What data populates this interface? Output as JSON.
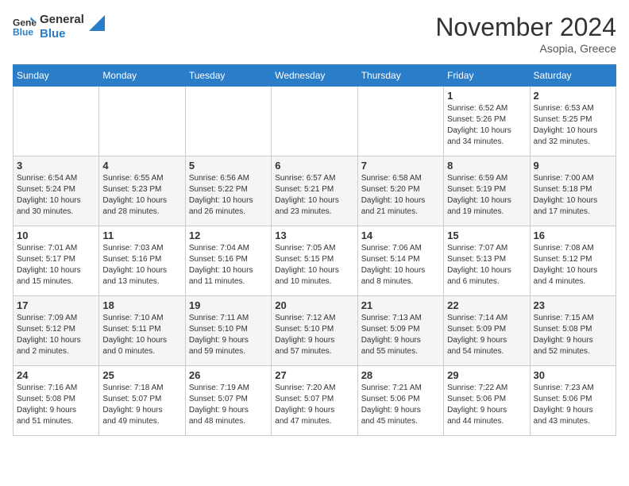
{
  "logo": {
    "line1": "General",
    "line2": "Blue"
  },
  "header": {
    "month": "November 2024",
    "location": "Asopia, Greece"
  },
  "weekdays": [
    "Sunday",
    "Monday",
    "Tuesday",
    "Wednesday",
    "Thursday",
    "Friday",
    "Saturday"
  ],
  "weeks": [
    [
      {
        "day": "",
        "info": ""
      },
      {
        "day": "",
        "info": ""
      },
      {
        "day": "",
        "info": ""
      },
      {
        "day": "",
        "info": ""
      },
      {
        "day": "",
        "info": ""
      },
      {
        "day": "1",
        "info": "Sunrise: 6:52 AM\nSunset: 5:26 PM\nDaylight: 10 hours\nand 34 minutes."
      },
      {
        "day": "2",
        "info": "Sunrise: 6:53 AM\nSunset: 5:25 PM\nDaylight: 10 hours\nand 32 minutes."
      }
    ],
    [
      {
        "day": "3",
        "info": "Sunrise: 6:54 AM\nSunset: 5:24 PM\nDaylight: 10 hours\nand 30 minutes."
      },
      {
        "day": "4",
        "info": "Sunrise: 6:55 AM\nSunset: 5:23 PM\nDaylight: 10 hours\nand 28 minutes."
      },
      {
        "day": "5",
        "info": "Sunrise: 6:56 AM\nSunset: 5:22 PM\nDaylight: 10 hours\nand 26 minutes."
      },
      {
        "day": "6",
        "info": "Sunrise: 6:57 AM\nSunset: 5:21 PM\nDaylight: 10 hours\nand 23 minutes."
      },
      {
        "day": "7",
        "info": "Sunrise: 6:58 AM\nSunset: 5:20 PM\nDaylight: 10 hours\nand 21 minutes."
      },
      {
        "day": "8",
        "info": "Sunrise: 6:59 AM\nSunset: 5:19 PM\nDaylight: 10 hours\nand 19 minutes."
      },
      {
        "day": "9",
        "info": "Sunrise: 7:00 AM\nSunset: 5:18 PM\nDaylight: 10 hours\nand 17 minutes."
      }
    ],
    [
      {
        "day": "10",
        "info": "Sunrise: 7:01 AM\nSunset: 5:17 PM\nDaylight: 10 hours\nand 15 minutes."
      },
      {
        "day": "11",
        "info": "Sunrise: 7:03 AM\nSunset: 5:16 PM\nDaylight: 10 hours\nand 13 minutes."
      },
      {
        "day": "12",
        "info": "Sunrise: 7:04 AM\nSunset: 5:16 PM\nDaylight: 10 hours\nand 11 minutes."
      },
      {
        "day": "13",
        "info": "Sunrise: 7:05 AM\nSunset: 5:15 PM\nDaylight: 10 hours\nand 10 minutes."
      },
      {
        "day": "14",
        "info": "Sunrise: 7:06 AM\nSunset: 5:14 PM\nDaylight: 10 hours\nand 8 minutes."
      },
      {
        "day": "15",
        "info": "Sunrise: 7:07 AM\nSunset: 5:13 PM\nDaylight: 10 hours\nand 6 minutes."
      },
      {
        "day": "16",
        "info": "Sunrise: 7:08 AM\nSunset: 5:12 PM\nDaylight: 10 hours\nand 4 minutes."
      }
    ],
    [
      {
        "day": "17",
        "info": "Sunrise: 7:09 AM\nSunset: 5:12 PM\nDaylight: 10 hours\nand 2 minutes."
      },
      {
        "day": "18",
        "info": "Sunrise: 7:10 AM\nSunset: 5:11 PM\nDaylight: 10 hours\nand 0 minutes."
      },
      {
        "day": "19",
        "info": "Sunrise: 7:11 AM\nSunset: 5:10 PM\nDaylight: 9 hours\nand 59 minutes."
      },
      {
        "day": "20",
        "info": "Sunrise: 7:12 AM\nSunset: 5:10 PM\nDaylight: 9 hours\nand 57 minutes."
      },
      {
        "day": "21",
        "info": "Sunrise: 7:13 AM\nSunset: 5:09 PM\nDaylight: 9 hours\nand 55 minutes."
      },
      {
        "day": "22",
        "info": "Sunrise: 7:14 AM\nSunset: 5:09 PM\nDaylight: 9 hours\nand 54 minutes."
      },
      {
        "day": "23",
        "info": "Sunrise: 7:15 AM\nSunset: 5:08 PM\nDaylight: 9 hours\nand 52 minutes."
      }
    ],
    [
      {
        "day": "24",
        "info": "Sunrise: 7:16 AM\nSunset: 5:08 PM\nDaylight: 9 hours\nand 51 minutes."
      },
      {
        "day": "25",
        "info": "Sunrise: 7:18 AM\nSunset: 5:07 PM\nDaylight: 9 hours\nand 49 minutes."
      },
      {
        "day": "26",
        "info": "Sunrise: 7:19 AM\nSunset: 5:07 PM\nDaylight: 9 hours\nand 48 minutes."
      },
      {
        "day": "27",
        "info": "Sunrise: 7:20 AM\nSunset: 5:07 PM\nDaylight: 9 hours\nand 47 minutes."
      },
      {
        "day": "28",
        "info": "Sunrise: 7:21 AM\nSunset: 5:06 PM\nDaylight: 9 hours\nand 45 minutes."
      },
      {
        "day": "29",
        "info": "Sunrise: 7:22 AM\nSunset: 5:06 PM\nDaylight: 9 hours\nand 44 minutes."
      },
      {
        "day": "30",
        "info": "Sunrise: 7:23 AM\nSunset: 5:06 PM\nDaylight: 9 hours\nand 43 minutes."
      }
    ]
  ]
}
